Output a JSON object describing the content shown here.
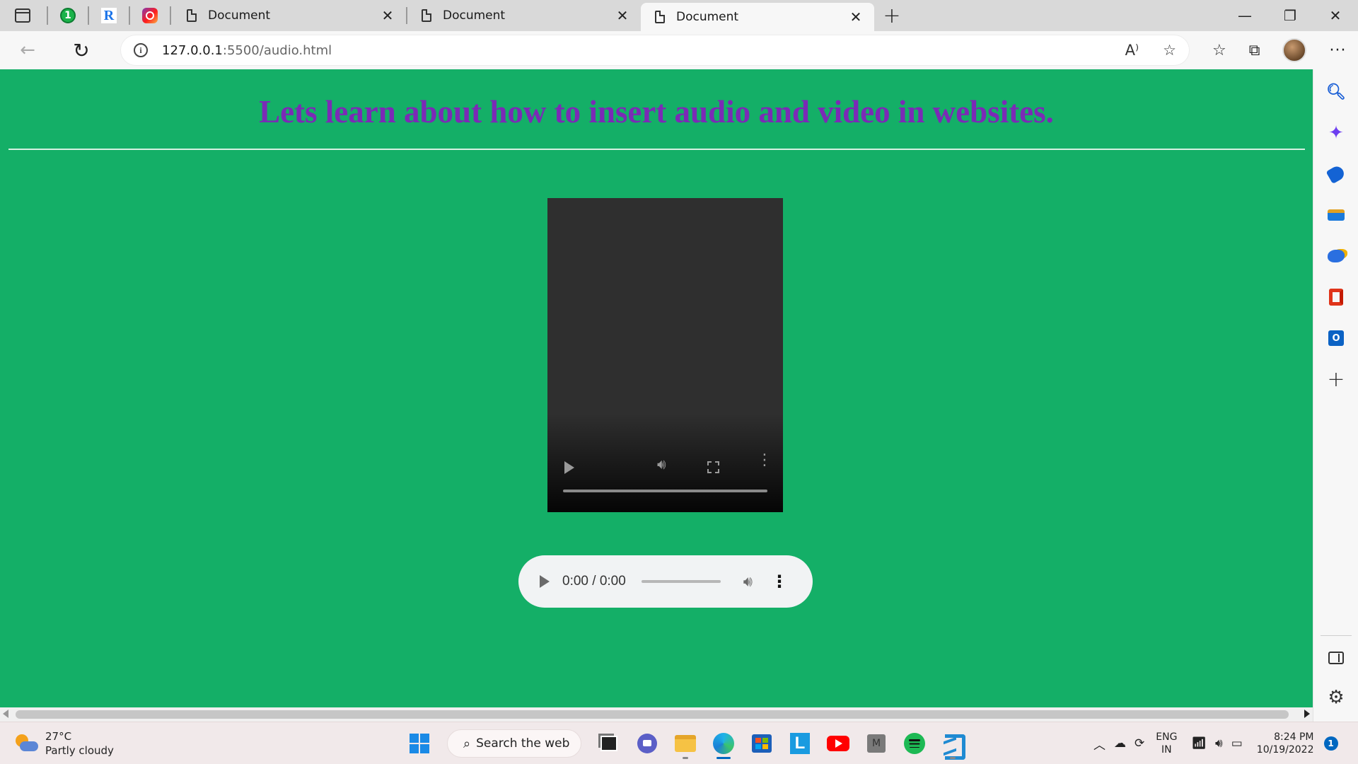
{
  "browser": {
    "tabs": [
      {
        "title": "Document",
        "close": "✕"
      },
      {
        "title": "Document",
        "close": "✕"
      },
      {
        "title": "Document",
        "close": "✕"
      }
    ],
    "pinned_tabs": [
      "1",
      "R"
    ],
    "new_tab": "+",
    "window_controls": {
      "minimize": "—",
      "maximize": "❐",
      "close": "✕"
    },
    "address": {
      "host": "127.0.0.1",
      "rest": ":5500/audio.html"
    },
    "info_glyph": "i",
    "read_aloud_glyph": "A⁾",
    "more_glyph": "···"
  },
  "page": {
    "heading": "Lets learn about how to insert audio and video in websites.",
    "audio": {
      "time": "0:00 / 0:00"
    }
  },
  "sidebar": {
    "outlook_glyph": "O",
    "add_glyph": "+"
  },
  "taskbar": {
    "weather_temp": "27°C",
    "weather_desc": "Partly cloudy",
    "search_label": "Search the web",
    "app_L": "L",
    "app_M": "M",
    "lang_top": "ENG",
    "lang_bottom": "IN",
    "time": "8:24 PM",
    "date": "10/19/2022",
    "notifications": "1"
  },
  "colors": {
    "page_background": "#14af67",
    "heading": "#7b2ab6",
    "accent": "#0067c0"
  },
  "icons": [
    "tab-actions-icon",
    "document-icon",
    "info-icon",
    "read-aloud-icon",
    "favorite-add-icon",
    "favorites-icon",
    "collections-icon",
    "search-icon",
    "copilot-icon",
    "shopping-tag-icon",
    "tools-icon",
    "games-icon",
    "office-icon",
    "outlook-icon",
    "add-icon",
    "panel-icon",
    "settings-icon",
    "windows-start-icon",
    "weather-icon"
  ]
}
